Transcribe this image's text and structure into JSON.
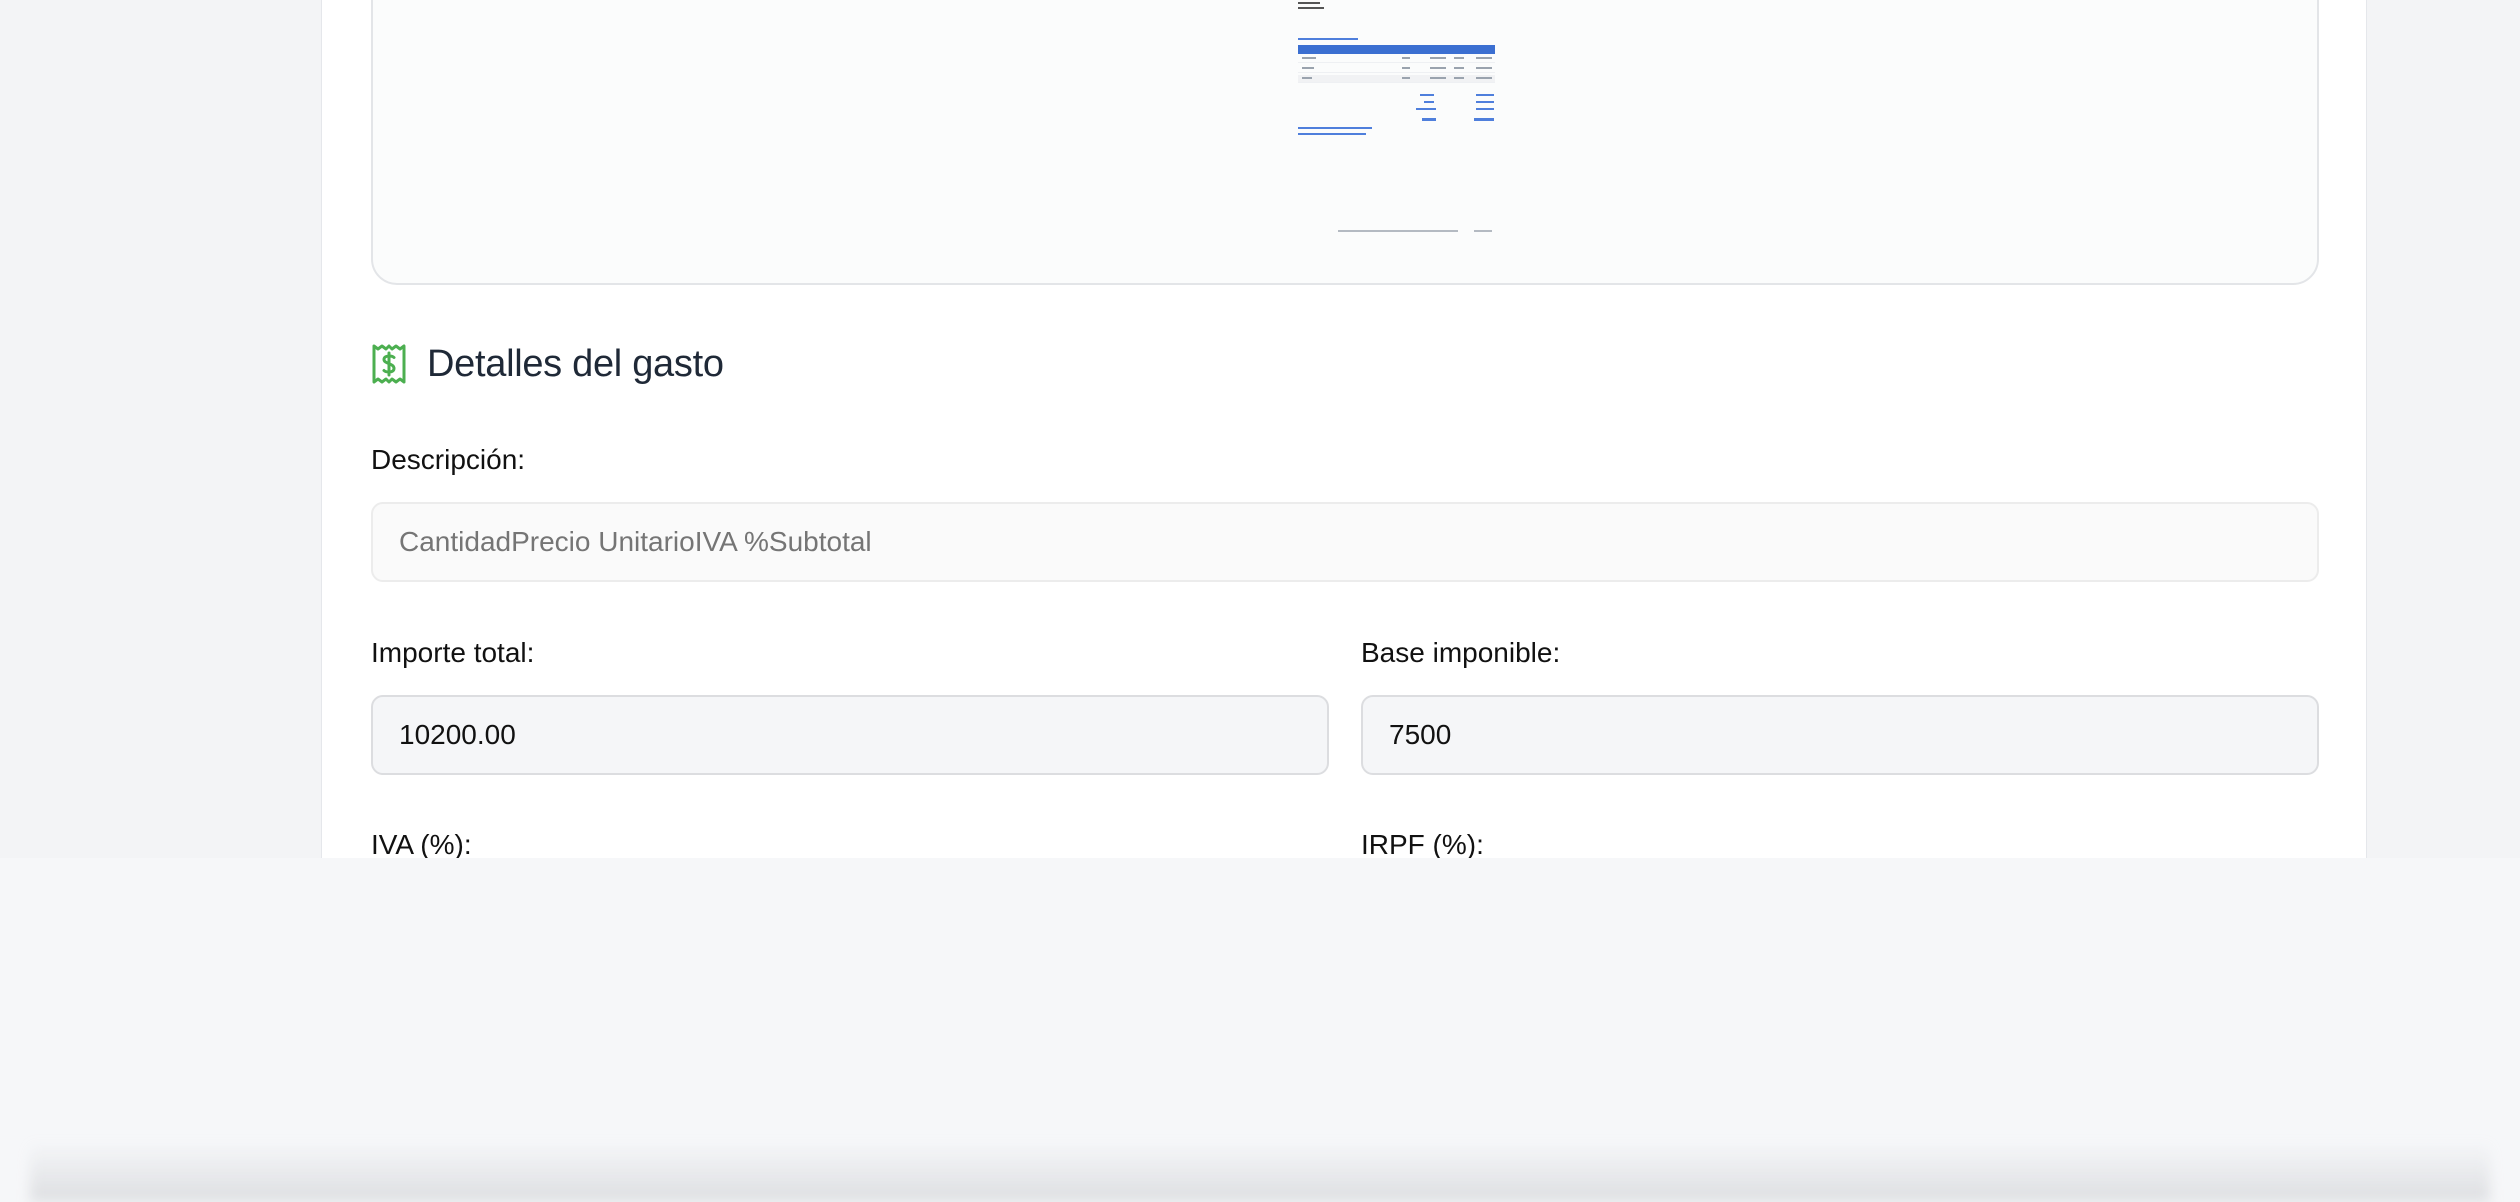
{
  "section": {
    "title": "Detalles del gasto",
    "icon": "receipt-dollar-icon",
    "icon_color": "#4caf50"
  },
  "fields": {
    "descripcion": {
      "label": "Descripción:",
      "placeholder": "CantidadPrecio UnitarioIVA %Subtotal",
      "value": ""
    },
    "importe_total": {
      "label": "Importe total:",
      "value": "10200.00"
    },
    "base_imponible": {
      "label": "Base imponible:",
      "value": "7500"
    },
    "iva": {
      "label": "IVA (%):"
    },
    "irpf": {
      "label": "IRPF (%):"
    }
  },
  "colors": {
    "background": "#f3f4f6",
    "card": "#ffffff",
    "field_border": "#e5e7eb",
    "invoice_accent": "#3b6fd1"
  }
}
